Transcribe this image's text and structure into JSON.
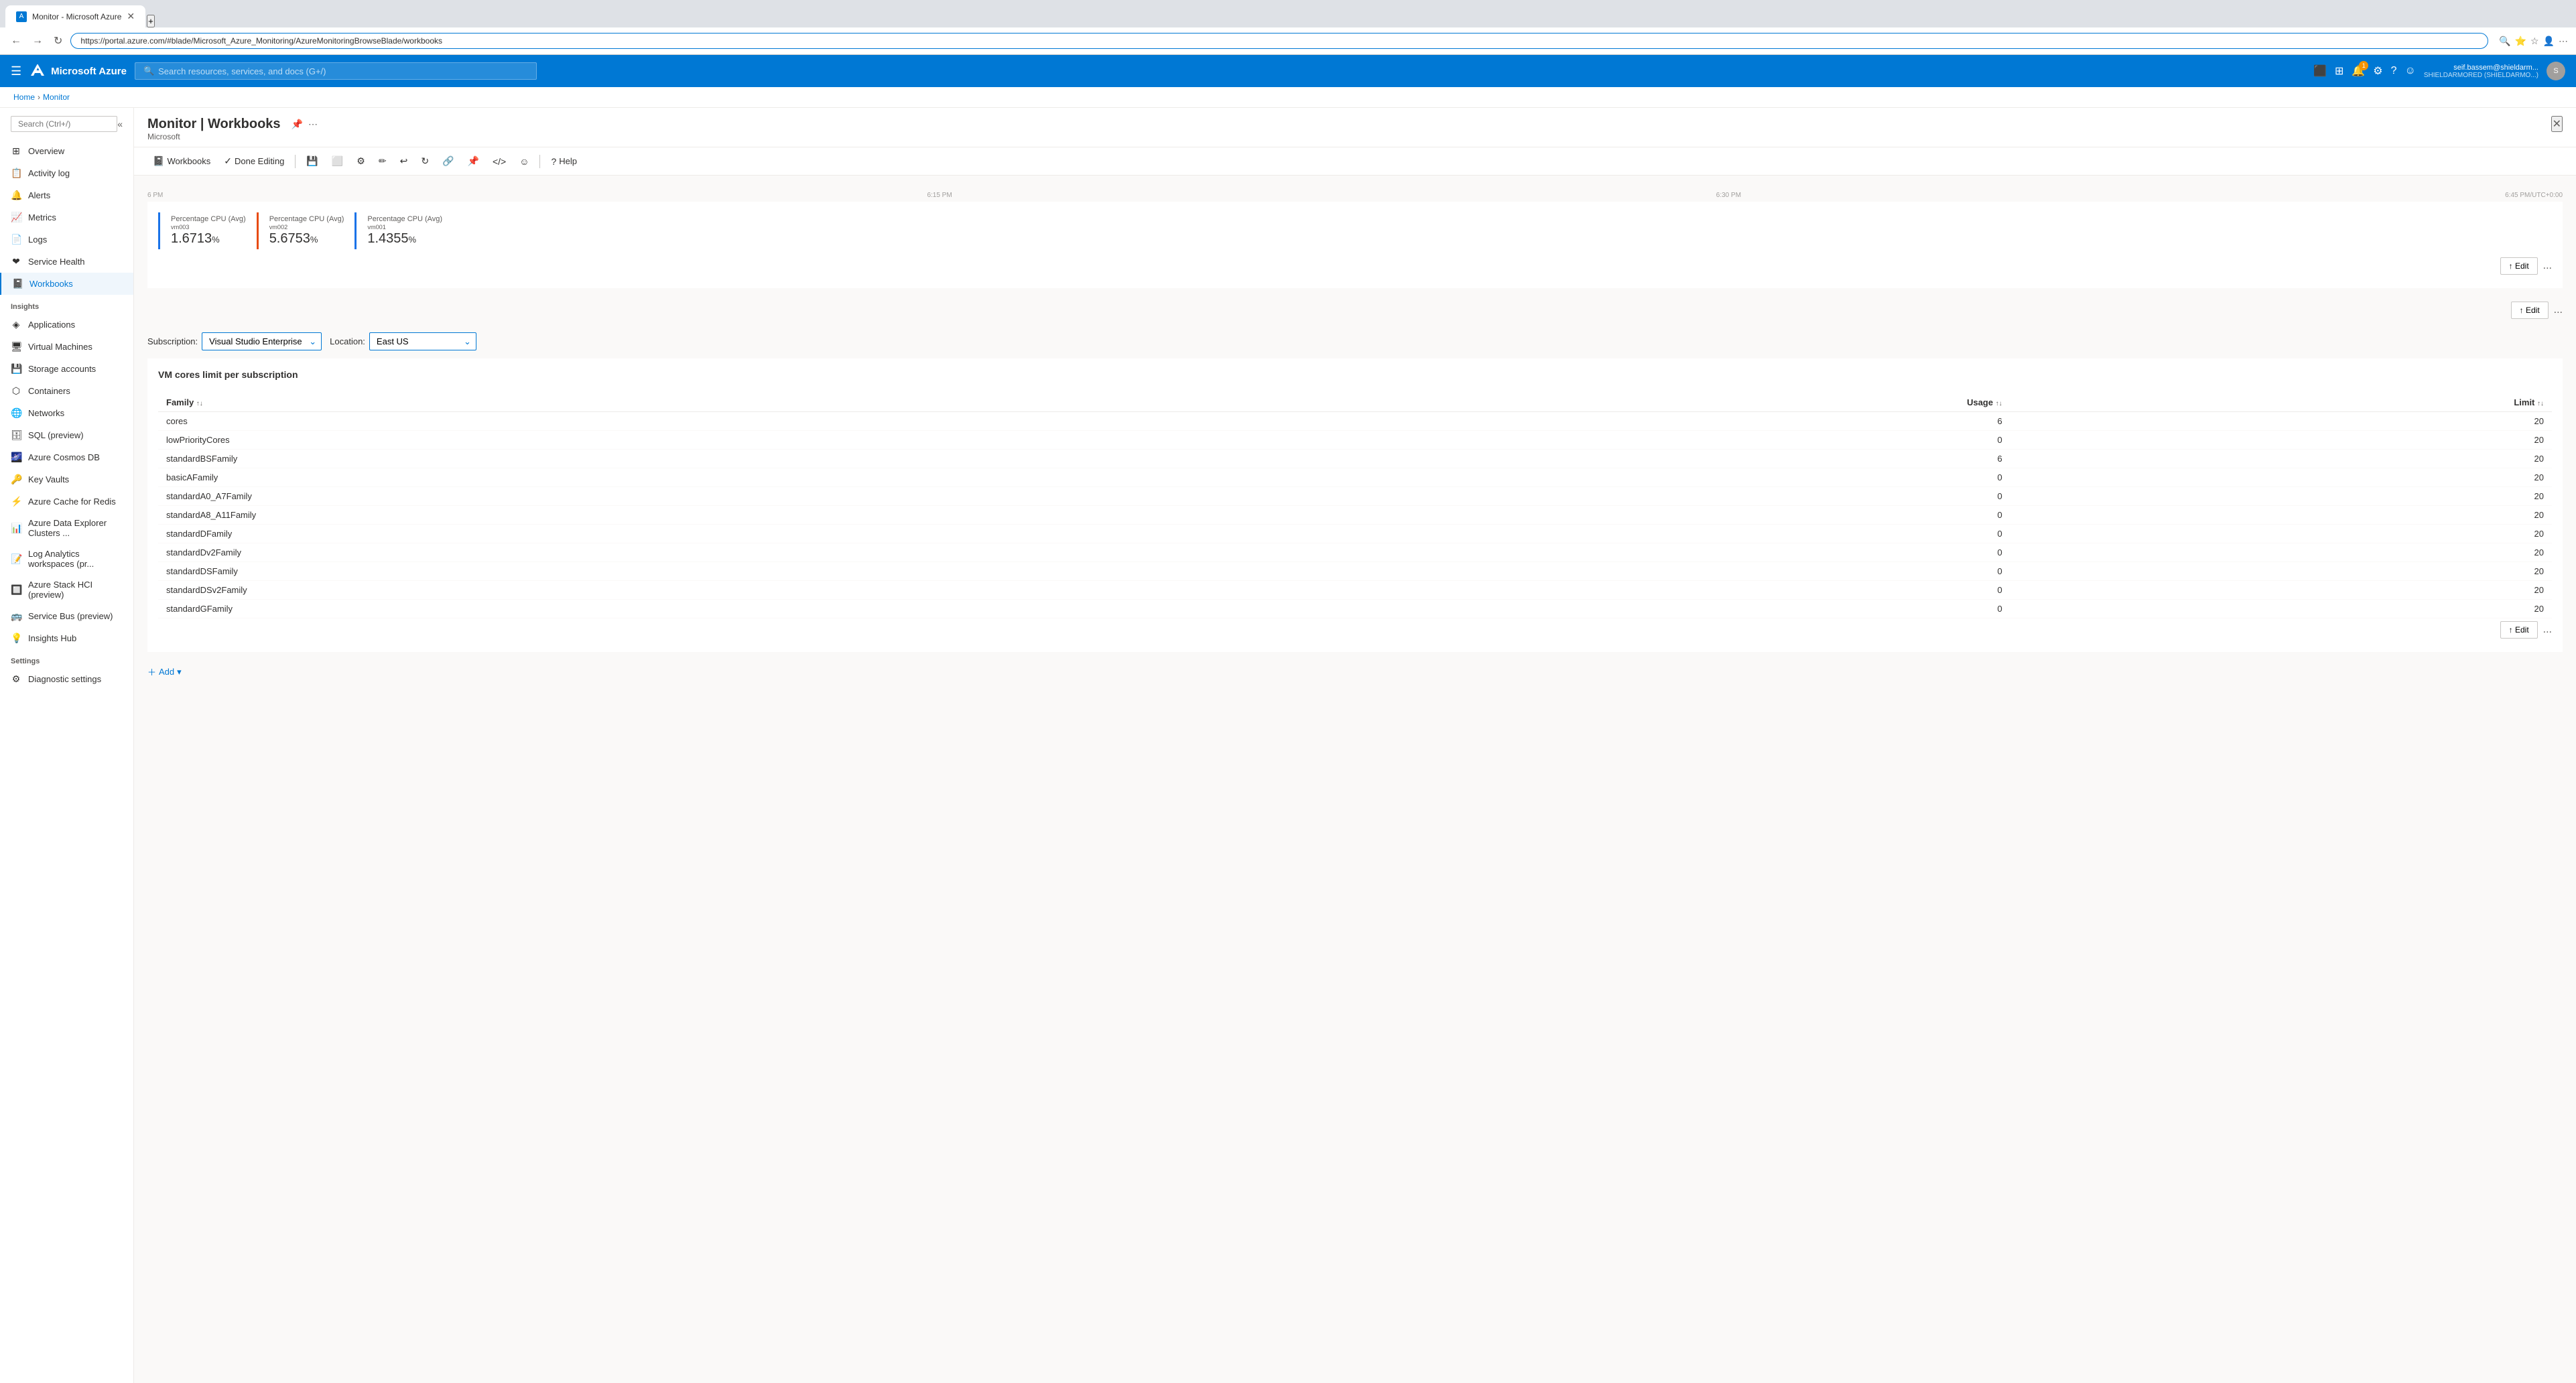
{
  "browser": {
    "tab_title": "Monitor - Microsoft Azure",
    "url": "https://portal.azure.com/#blade/Microsoft_Azure_Monitoring/AzureMonitoringBrowseBlade/workbooks",
    "new_tab_label": "+"
  },
  "topbar": {
    "app_name": "Microsoft Azure",
    "search_placeholder": "Search resources, services, and docs (G+/)",
    "notification_count": "1",
    "user_email": "seif.bassem@shieldarm...",
    "user_org": "SHIELDARMORED (SHIELDARMO...)"
  },
  "breadcrumb": {
    "home": "Home",
    "section": "Monitor"
  },
  "page": {
    "title": "Monitor | Workbooks",
    "subtitle": "Microsoft",
    "close_label": "✕"
  },
  "toolbar": {
    "items": [
      {
        "id": "workbooks",
        "label": "Workbooks",
        "icon": "📓"
      },
      {
        "id": "done-editing",
        "label": "Done Editing",
        "icon": "✓"
      },
      {
        "id": "save",
        "label": "",
        "icon": "💾"
      },
      {
        "id": "gallery",
        "label": "",
        "icon": "⬜"
      },
      {
        "id": "settings",
        "label": "",
        "icon": "⚙"
      },
      {
        "id": "edit",
        "label": "",
        "icon": "✏"
      },
      {
        "id": "undo",
        "label": "",
        "icon": "↩"
      },
      {
        "id": "refresh",
        "label": "",
        "icon": "↻"
      },
      {
        "id": "share",
        "label": "",
        "icon": "🔗"
      },
      {
        "id": "link",
        "label": "",
        "icon": "📎"
      },
      {
        "id": "code",
        "label": "",
        "icon": "</>"
      },
      {
        "id": "emoji",
        "label": "",
        "icon": "☺"
      },
      {
        "id": "help",
        "label": "Help",
        "icon": "?"
      }
    ]
  },
  "sidebar": {
    "search_placeholder": "Search (Ctrl+/)",
    "nav_items": [
      {
        "id": "overview",
        "label": "Overview",
        "icon": "⊞"
      },
      {
        "id": "activity-log",
        "label": "Activity log",
        "icon": "📋"
      },
      {
        "id": "alerts",
        "label": "Alerts",
        "icon": "🔔"
      },
      {
        "id": "metrics",
        "label": "Metrics",
        "icon": "📈"
      },
      {
        "id": "logs",
        "label": "Logs",
        "icon": "📄"
      },
      {
        "id": "service-health",
        "label": "Service Health",
        "icon": "❤"
      },
      {
        "id": "workbooks",
        "label": "Workbooks",
        "icon": "📓",
        "active": true
      }
    ],
    "insights_section": "Insights",
    "insights_items": [
      {
        "id": "applications",
        "label": "Applications",
        "icon": "◈"
      },
      {
        "id": "virtual-machines",
        "label": "Virtual Machines",
        "icon": "🖥"
      },
      {
        "id": "storage-accounts",
        "label": "Storage accounts",
        "icon": "💾"
      },
      {
        "id": "containers",
        "label": "Containers",
        "icon": "⬡"
      },
      {
        "id": "networks",
        "label": "Networks",
        "icon": "🌐"
      },
      {
        "id": "sql-preview",
        "label": "SQL (preview)",
        "icon": "🗄"
      },
      {
        "id": "azure-cosmos-db",
        "label": "Azure Cosmos DB",
        "icon": "🌌"
      },
      {
        "id": "key-vaults",
        "label": "Key Vaults",
        "icon": "🔑"
      },
      {
        "id": "azure-cache-redis",
        "label": "Azure Cache for Redis",
        "icon": "⚡"
      },
      {
        "id": "azure-data-explorer",
        "label": "Azure Data Explorer Clusters ...",
        "icon": "📊"
      },
      {
        "id": "log-analytics",
        "label": "Log Analytics workspaces (pr...",
        "icon": "📝"
      },
      {
        "id": "azure-stack-hci",
        "label": "Azure Stack HCI (preview)",
        "icon": "🔲"
      },
      {
        "id": "service-bus",
        "label": "Service Bus (preview)",
        "icon": "🚌"
      },
      {
        "id": "insights-hub",
        "label": "Insights Hub",
        "icon": "💡"
      }
    ],
    "settings_section": "Settings",
    "settings_items": [
      {
        "id": "diagnostic-settings",
        "label": "Diagnostic settings",
        "icon": "⚙"
      }
    ]
  },
  "cpu_metrics": [
    {
      "label": "Percentage CPU (Avg)",
      "sublabel": "vm003",
      "value": "1.6713",
      "unit": "%",
      "color": "#1a73e8"
    },
    {
      "label": "Percentage CPU (Avg)",
      "sublabel": "vm002",
      "value": "5.6753",
      "unit": "%",
      "color": "#e84c13"
    },
    {
      "label": "Percentage CPU (Avg)",
      "sublabel": "vm001",
      "value": "1.4355",
      "unit": "%",
      "color": "#1a73e8"
    }
  ],
  "chart_times": [
    "6 PM",
    "6:15 PM",
    "6:30 PM",
    "6:45 PM/UTC+0:00"
  ],
  "filters": {
    "subscription_label": "Subscription:",
    "subscription_value": "Visual Studio Enterprise",
    "location_label": "Location:",
    "location_value": "East US"
  },
  "table": {
    "title": "VM cores limit per subscription",
    "columns": [
      {
        "label": "Family",
        "sortable": true
      },
      {
        "label": "Usage↑↓",
        "sortable": true
      },
      {
        "label": "Limit↑↓",
        "sortable": true
      }
    ],
    "rows": [
      {
        "family": "cores",
        "usage": 6,
        "limit": 20
      },
      {
        "family": "lowPriorityCores",
        "usage": 0,
        "limit": 20
      },
      {
        "family": "standardBSFamily",
        "usage": 6,
        "limit": 20
      },
      {
        "family": "basicAFamily",
        "usage": 0,
        "limit": 20
      },
      {
        "family": "standardA0_A7Family",
        "usage": 0,
        "limit": 20
      },
      {
        "family": "standardA8_A11Family",
        "usage": 0,
        "limit": 20
      },
      {
        "family": "standardDFamily",
        "usage": 0,
        "limit": 20
      },
      {
        "family": "standardDv2Family",
        "usage": 0,
        "limit": 20
      },
      {
        "family": "standardDSFamily",
        "usage": 0,
        "limit": 20
      },
      {
        "family": "standardDSv2Family",
        "usage": 0,
        "limit": 20
      },
      {
        "family": "standardGFamily",
        "usage": 0,
        "limit": 20
      }
    ]
  },
  "buttons": {
    "edit_label": "↑ Edit",
    "more_label": "...",
    "add_label": "Add",
    "done_editing_label": "Done Editing"
  },
  "colors": {
    "azure_blue": "#0078d4",
    "accent": "#0078d4",
    "border": "#edebe9",
    "bg": "#faf9f8"
  }
}
